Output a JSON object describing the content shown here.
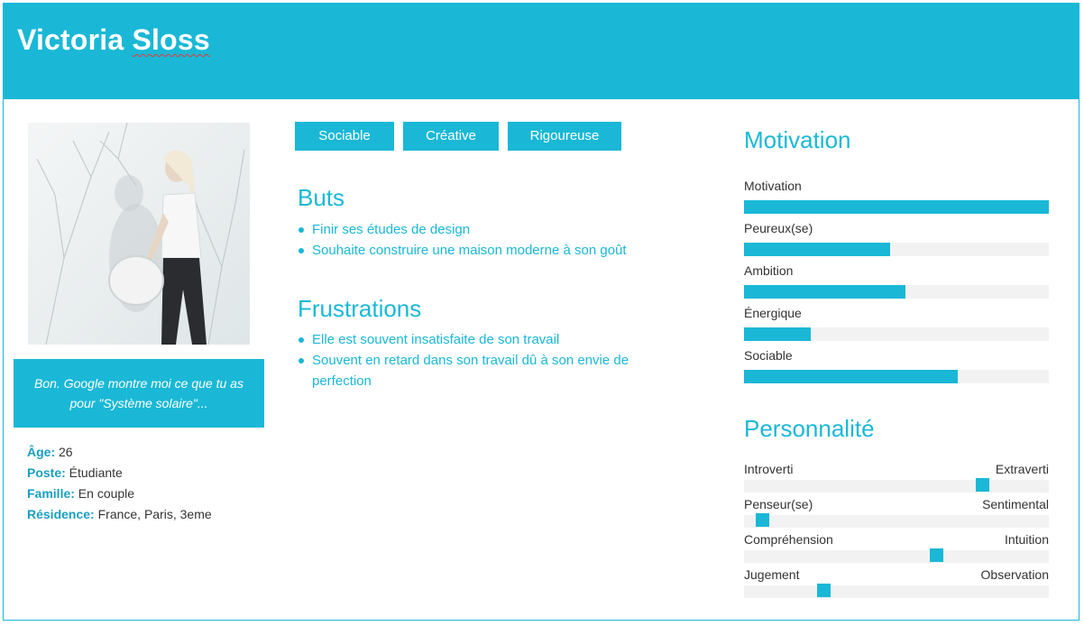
{
  "header": {
    "name_first": "Victoria",
    "name_last": "Sloss"
  },
  "photo": {
    "alt": "Portrait of Victoria Sloss holding a round plate"
  },
  "quote": "Bon. Google montre moi ce que tu as pour \"Système solaire\"...",
  "info": [
    {
      "label": "Âge",
      "value": " 26"
    },
    {
      "label": "Poste",
      "value": " Étudiante"
    },
    {
      "label": "Famille",
      "value": " En couple"
    },
    {
      "label": "Résidence",
      "value": " France, Paris, 3eme"
    }
  ],
  "tags": [
    "Sociable",
    "Créative",
    "Rigoureuse"
  ],
  "goals": {
    "title": "Buts",
    "items": [
      "Finir ses études de design",
      "Souhaite construire une maison moderne à son goût"
    ]
  },
  "frustrations": {
    "title": "Frustrations",
    "items": [
      "Elle est souvent insatisfaite de son travail",
      "Souvent en retard dans son travail dû à son envie de perfection"
    ]
  },
  "motivation": {
    "title": "Motivation",
    "items": [
      {
        "label": "Motivation",
        "value": 100
      },
      {
        "label": "Peureux(se)",
        "value": 48
      },
      {
        "label": "Ambition",
        "value": 53
      },
      {
        "label": "Énergique",
        "value": 22
      },
      {
        "label": "Sociable",
        "value": 70
      }
    ]
  },
  "personality": {
    "title": "Personnalité",
    "items": [
      {
        "left": "Introverti",
        "right": "Extraverti",
        "value": 78
      },
      {
        "left": "Penseur(se)",
        "right": "Sentimental",
        "value": 6
      },
      {
        "left": "Compréhension",
        "right": "Intuition",
        "value": 63
      },
      {
        "left": "Jugement",
        "right": "Observation",
        "value": 26
      }
    ]
  },
  "colors": {
    "accent": "#1ab8d6",
    "track": "#f2f2f2"
  }
}
